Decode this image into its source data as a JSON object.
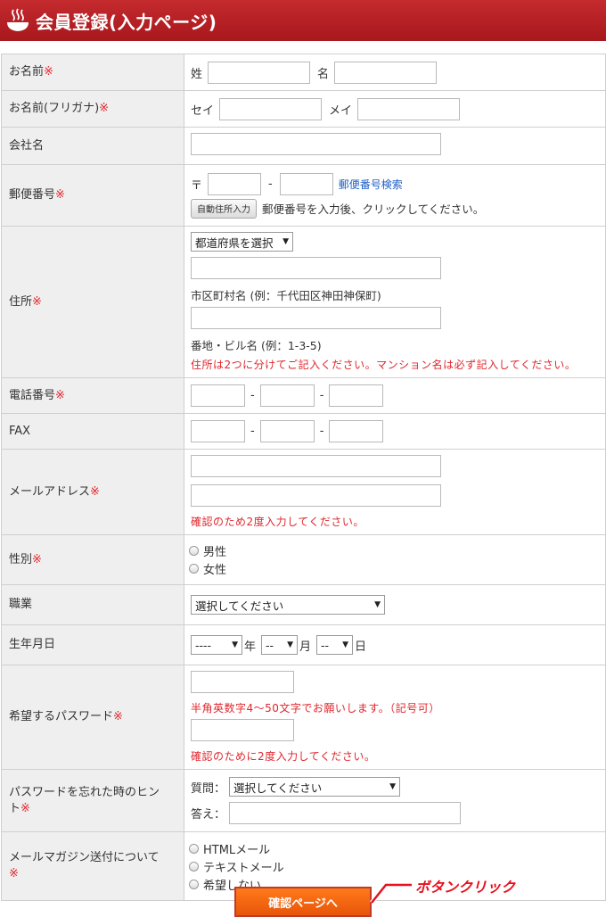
{
  "header": {
    "title": "会員登録(入力ページ)",
    "icon": "bowl-icon"
  },
  "required_mark": "※",
  "rows": {
    "name": {
      "label": "お名前",
      "sei": "姓",
      "mei": "名"
    },
    "kana": {
      "label": "お名前(フリガナ)",
      "sei": "セイ",
      "mei": "メイ"
    },
    "company": {
      "label": "会社名"
    },
    "postal": {
      "label": "郵便番号",
      "prefix": "〒",
      "dash": "-",
      "search_link": "郵便番号検索",
      "auto_button": "自動住所入力",
      "auto_hint": "郵便番号を入力後、クリックしてください。"
    },
    "address": {
      "label": "住所",
      "pref_select": "都道府県を選択",
      "city_hint": "市区町村名 (例：千代田区神田神保町)",
      "street_hint": "番地・ビル名 (例：1-3-5)",
      "note": "住所は2つに分けてご記入ください。マンション名は必ず記入してください。"
    },
    "tel": {
      "label": "電話番号",
      "dash": "-"
    },
    "fax": {
      "label": "FAX",
      "dash": "-"
    },
    "email": {
      "label": "メールアドレス",
      "note": "確認のため2度入力してください。"
    },
    "gender": {
      "label": "性別",
      "options": [
        "男性",
        "女性"
      ]
    },
    "job": {
      "label": "職業",
      "select": "選択してください"
    },
    "birth": {
      "label": "生年月日",
      "year_sel": "----",
      "year": "年",
      "month_sel": "--",
      "month": "月",
      "day_sel": "--",
      "day": "日"
    },
    "password": {
      "label": "希望するパスワード",
      "note1": "半角英数字4～50文字でお願いします。（記号可）",
      "note2": "確認のために2度入力してください。"
    },
    "hint": {
      "label1": "パスワードを忘れた時のヒン",
      "label2": "ト",
      "question": "質問：",
      "select": "選択してください",
      "answer": "答え："
    },
    "magazine": {
      "label1": "メールマガジン送付について",
      "options": [
        "HTMLメール",
        "テキストメール",
        "希望しない"
      ]
    }
  },
  "confirm_button": "確認ページへ",
  "callout": "ボタンクリック"
}
